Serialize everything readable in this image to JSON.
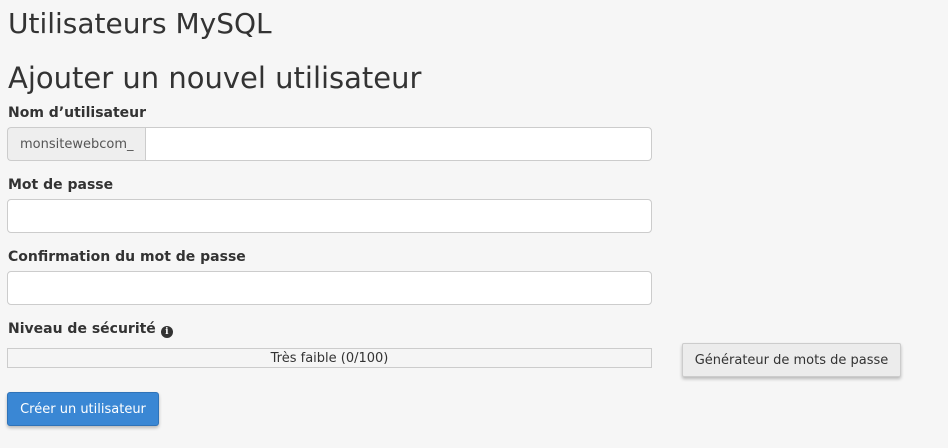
{
  "page": {
    "title": "Utilisateurs MySQL",
    "section_title": "Ajouter un nouvel utilisateur"
  },
  "form": {
    "username_label": "Nom d’utilisateur",
    "username_prefix": "monsitewebcom_",
    "username_value": "",
    "password_label": "Mot de passe",
    "password_value": "",
    "confirm_label": "Confirmation du mot de passe",
    "confirm_value": "",
    "strength_label": "Niveau de sécurité",
    "strength_icon": "info-circle-icon",
    "strength_text": "Très faible (0/100)",
    "strength_score": 0,
    "strength_color": "#d9534f",
    "generator_button": "Générateur de mots de passe",
    "create_button": "Créer un utilisateur"
  },
  "colors": {
    "primary_button": "#3a87d4",
    "background": "#f6f6f6"
  }
}
